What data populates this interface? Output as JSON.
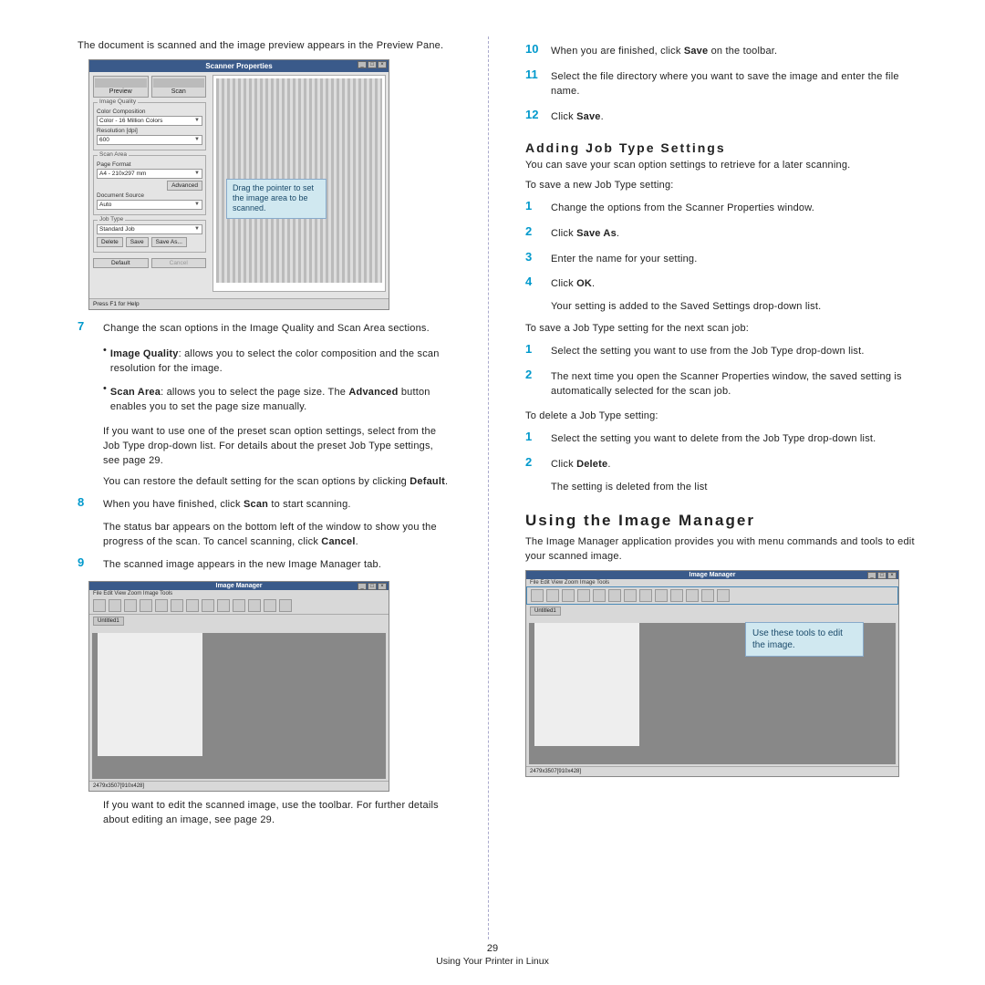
{
  "left": {
    "intro": "The document is scanned and the image preview appears in the Preview Pane.",
    "dialog": {
      "title": "Scanner Properties",
      "preview_btn": "Preview",
      "scan_btn": "Scan",
      "quality_legend": "Image Quality",
      "color_label": "Color Composition",
      "color_value": "Color - 16 Million Colors",
      "res_label": "Resolution [dpi]",
      "res_value": "600",
      "area_legend": "Scan Area",
      "page_label": "Page Format",
      "page_value": "A4 - 210x297 mm",
      "advanced": "Advanced",
      "doc_label": "Document Source",
      "doc_value": "Auto",
      "jobtype_legend": "Job Type",
      "jobtype_value": "Standard Job",
      "delete": "Delete",
      "save": "Save",
      "saveas": "Save As...",
      "default": "Default",
      "cancel": "Cancel",
      "status": "Press F1 for Help",
      "callout": "Drag the pointer to set the image area to be scanned."
    },
    "step7_num": "7",
    "step7": "Change the scan options in the Image Quality and Scan Area sections.",
    "bullet1a": "Image Quality",
    "bullet1b": ": allows you to select the color composition and the scan resolution for the image.",
    "bullet2a": "Scan Area",
    "bullet2b": ": allows you to select the page size. The ",
    "bullet2c": "Advanced",
    "bullet2d": " button enables you to set the page size manually.",
    "para1": "If you want to use one of the preset scan option settings, select from the Job Type drop-down list. For details about the preset Job Type settings, see page 29.",
    "para2a": "You can restore the default setting for the scan options by clicking ",
    "para2b": "Default",
    "para2c": ".",
    "step8_num": "8",
    "step8a": "When you have finished, click ",
    "step8b": "Scan",
    "step8c": " to start scanning.",
    "step8_para": "The status bar appears on the bottom left of the window to show you the progress of the scan. To cancel scanning, click ",
    "step8_cancel": "Cancel",
    "step8_dot": ".",
    "step9_num": "9",
    "step9": "The scanned image appears in the new Image Manager tab.",
    "im": {
      "title": "Image Manager",
      "menu": "File   Edit   View   Zoom   Image   Tools",
      "tools": [
        "Save",
        "",
        "",
        "Zoom Out",
        "Zoom In",
        "Scroll",
        "Crop",
        "Scale",
        "Rotate",
        "Flip",
        "Brightness",
        "",
        "Properties"
      ],
      "tab": "Untitled1",
      "status": "2479x3507[910x428]"
    },
    "after_im": "If you want to edit the scanned image, use the toolbar. For further details about editing an image, see page 29."
  },
  "right": {
    "step10_num": "10",
    "step10a": "When you are finished, click ",
    "step10b": "Save",
    "step10c": " on the toolbar.",
    "step11_num": "11",
    "step11": "Select the file directory where you want to save the image and enter the file name.",
    "step12_num": "12",
    "step12a": "Click ",
    "step12b": "Save",
    "step12c": ".",
    "h3": "Adding Job Type Settings",
    "p1": "You can save your scan option settings to retrieve for a later scanning.",
    "p2": "To save a new Job Type setting:",
    "s1_num": "1",
    "s1": "Change the options from the Scanner Properties window.",
    "s2_num": "2",
    "s2a": "Click ",
    "s2b": "Save As",
    "s2c": ".",
    "s3_num": "3",
    "s3": "Enter the name for your setting.",
    "s4_num": "4",
    "s4a": "Click ",
    "s4b": "OK",
    "s4c": ".",
    "s4_para": "Your setting is added to the Saved Settings drop-down list.",
    "p3": "To save a Job Type setting for the next scan job:",
    "t1_num": "1",
    "t1": "Select the setting you want to use from the Job Type drop-down list.",
    "t2_num": "2",
    "t2": "The next time you open the Scanner Properties window, the saved setting is automatically selected for the scan job.",
    "p4": "To delete a Job Type setting:",
    "d1_num": "1",
    "d1": "Select the setting you want to delete from the Job Type drop-down list.",
    "d2_num": "2",
    "d2a": "Click ",
    "d2b": "Delete",
    "d2c": ".",
    "d2_para": "The setting is deleted from the list",
    "h2": "Using the Image Manager",
    "p5": "The Image Manager application provides you with menu commands and tools to edit your scanned image.",
    "im2": {
      "title": "Image Manager",
      "menu": "File   Edit   View   Zoom   Image   Tools",
      "tab": "Untitled1",
      "status": "2479x3507[910x428]",
      "callout": "Use these tools to edit the image."
    }
  },
  "footer": {
    "page": "29",
    "text": "Using Your Printer in Linux"
  }
}
